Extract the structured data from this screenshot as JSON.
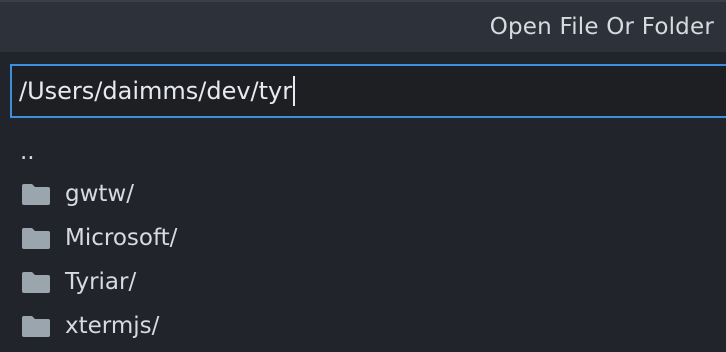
{
  "header": {
    "title": "Open File Or Folder"
  },
  "input": {
    "value": "/Users/daimms/dev/tyr"
  },
  "entries": [
    {
      "label": "..",
      "type": "parent"
    },
    {
      "label": "gwtw/",
      "type": "folder",
      "icon": "folder-icon"
    },
    {
      "label": "Microsoft/",
      "type": "folder",
      "icon": "folder-icon"
    },
    {
      "label": "Tyriar/",
      "type": "folder",
      "icon": "folder-icon"
    },
    {
      "label": "xtermjs/",
      "type": "folder",
      "icon": "folder-icon"
    }
  ],
  "colors": {
    "background": "#21252b",
    "header_background": "#2c313a",
    "focus_border": "#3e8ede",
    "text": "#d7dae0",
    "folder_icon": "#9aa5ad"
  }
}
